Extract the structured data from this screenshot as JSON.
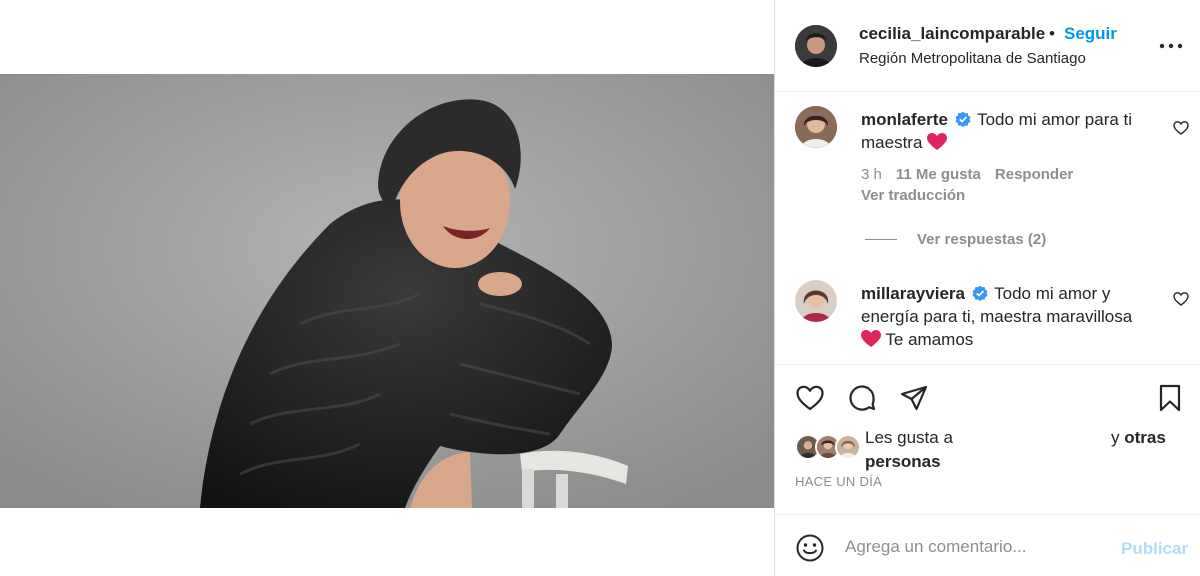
{
  "post": {
    "username": "cecilia_laincomparable",
    "separator": "•",
    "follow_label": "Seguir",
    "location": "Región Metropolitana de Santiago"
  },
  "comments": [
    {
      "username": "monlaferte",
      "text": "Todo mi amor para ti maestra",
      "time": "3 h",
      "likes": "11 Me gusta",
      "reply_label": "Responder",
      "translate_label": "Ver traducción",
      "view_replies": "Ver respuestas (2)"
    },
    {
      "username": "millarayviera",
      "text": "Todo mi amor y energía para ti, maestra maravillosa",
      "text_end": "Te amamos"
    }
  ],
  "likes": {
    "prefix": "Les gusta a",
    "and": "y",
    "others": "otras",
    "people": "personas"
  },
  "timeago": "HACE UN DÍA",
  "add_comment": {
    "placeholder": "Agrega un comentario...",
    "post_label": "Publicar"
  },
  "colors": {
    "accent": "#0095f6",
    "post_disabled": "#b3dbff",
    "heart_emoji": "#e0245e",
    "verified": "#3897f0"
  }
}
